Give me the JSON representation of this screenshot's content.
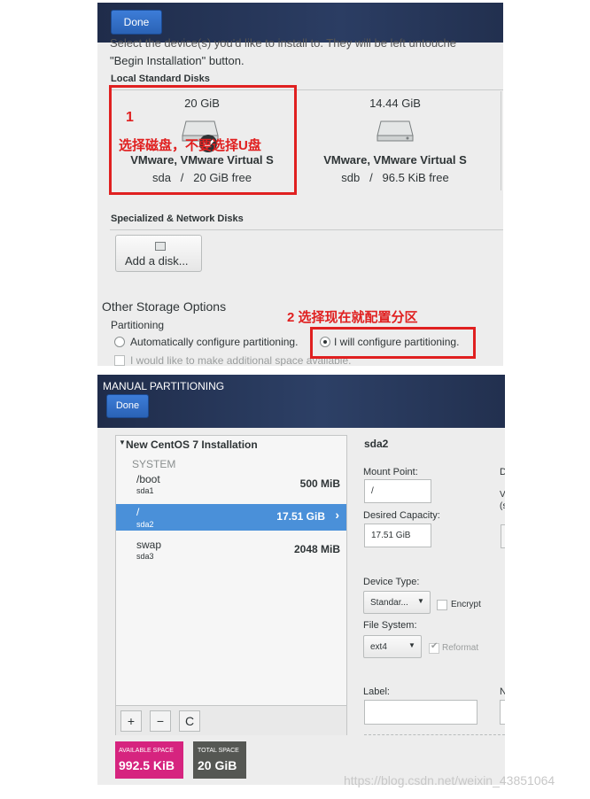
{
  "install": {
    "done_label": "Done",
    "intro_line1": "Select the device(s) you'd like to install to. They will be left untouche",
    "intro_line2": "\"Begin Installation\" button.",
    "local_disks_title": "Local Standard Disks",
    "disks": [
      {
        "size": "20 GiB",
        "name": "VMware, VMware Virtual S",
        "info": "sda   /   20 GiB free"
      },
      {
        "size": "14.44 GiB",
        "name": "VMware, VMware Virtual S",
        "info": "sdb   /   96.5 KiB free"
      }
    ],
    "specialized_title": "Specialized & Network Disks",
    "add_disk_label": "Add a disk...",
    "other_storage_title": "Other Storage Options",
    "partitioning_title": "Partitioning",
    "auto_partition_label": "Automatically configure partitioning.",
    "manual_partition_label": "I will configure partitioning.",
    "extra_space_label": "I would like to make additional space available.",
    "annotation_1_number": "1",
    "annotation_1_text": "选择磁盘，不要选择U盘",
    "annotation_2_text": "2 选择现在就配置分区"
  },
  "manual": {
    "title": "MANUAL PARTITIONING",
    "done_label": "Done",
    "installation_title": "New CentOS 7 Installation",
    "system_label": "SYSTEM",
    "partitions": [
      {
        "mount": "/boot",
        "device": "sda1",
        "size": "500 MiB",
        "selected": false
      },
      {
        "mount": "/",
        "device": "sda2",
        "size": "17.51 GiB",
        "selected": true
      },
      {
        "mount": "swap",
        "device": "sda3",
        "size": "2048 MiB",
        "selected": false
      }
    ],
    "toolbar": {
      "add": "+",
      "remove": "−",
      "refresh": "C"
    },
    "detail": {
      "device_title": "sda2",
      "mount_point_label": "Mount Point:",
      "mount_point_value": "/",
      "desired_capacity_label": "Desired Capacity:",
      "desired_capacity_value": "17.51 GiB",
      "device_type_label": "Device Type:",
      "device_type_value": "Standar...",
      "encrypt_label": "Encrypt",
      "file_system_label": "File System:",
      "file_system_value": "ext4",
      "reformat_label": "Reformat",
      "label_label": "Label:",
      "label_value": "",
      "cut_d": "D",
      "cut_v": "V",
      "cut_s": "(s",
      "cut_n": "N"
    },
    "available_space_caption": "AVAILABLE SPACE",
    "available_space_value": "992.5 KiB",
    "total_space_caption": "TOTAL SPACE",
    "total_space_value": "20 GiB"
  },
  "watermark": "https://blog.csdn.net/weixin_43851064",
  "colors": {
    "annotation_red": "#e02020",
    "selected_blue": "#4a90d9",
    "available_pink": "#d6247f",
    "total_gray": "#555753"
  },
  "icons": [
    "hard-disk-icon",
    "disk-small-icon",
    "chevron-right-icon",
    "dropdown-arrow-icon",
    "refresh-icon"
  ]
}
